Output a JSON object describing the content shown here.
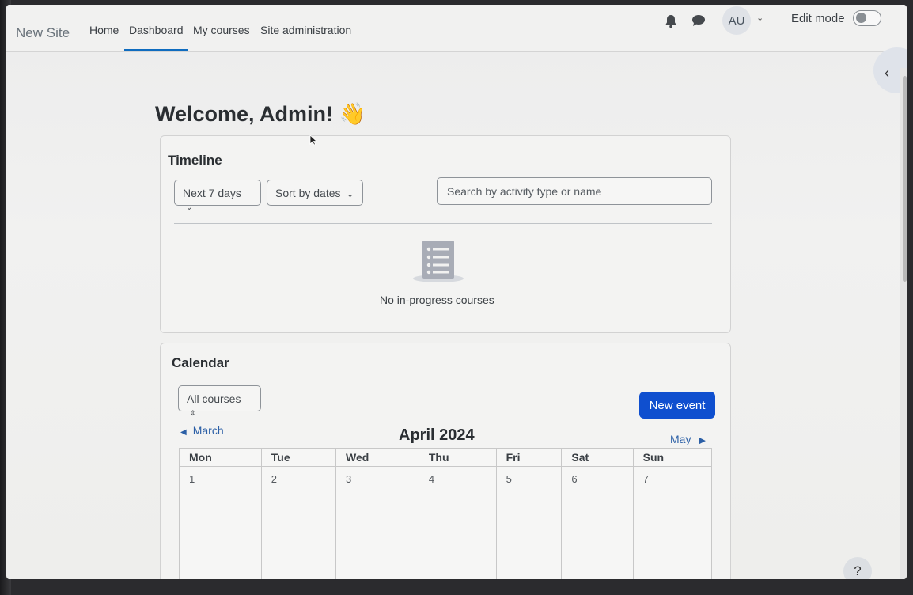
{
  "navbar": {
    "brand": "New Site",
    "links": [
      "Home",
      "Dashboard",
      "My courses",
      "Site administration"
    ],
    "active": "Dashboard",
    "avatar_initials": "AU",
    "edit_mode_label": "Edit mode",
    "edit_mode_on": false
  },
  "welcome": "Welcome, Admin! 👋",
  "timeline": {
    "title": "Timeline",
    "filter_label": "Next 7 days",
    "sort_label": "Sort by dates",
    "search_placeholder": "Search by activity type or name",
    "empty_message": "No in-progress courses"
  },
  "calendar": {
    "title": "Calendar",
    "course_filter": "All courses",
    "new_event_label": "New event",
    "prev_month": "March",
    "current_month": "April 2024",
    "next_month": "May",
    "weekdays": [
      "Mon",
      "Tue",
      "Wed",
      "Thu",
      "Fri",
      "Sat",
      "Sun"
    ],
    "first_week": [
      "1",
      "2",
      "3",
      "4",
      "5",
      "6",
      "7"
    ]
  },
  "help_label": "?",
  "colors": {
    "primary": "#0f4fcf",
    "link": "#2b5fa6",
    "active_underline": "#0f6cbf"
  }
}
